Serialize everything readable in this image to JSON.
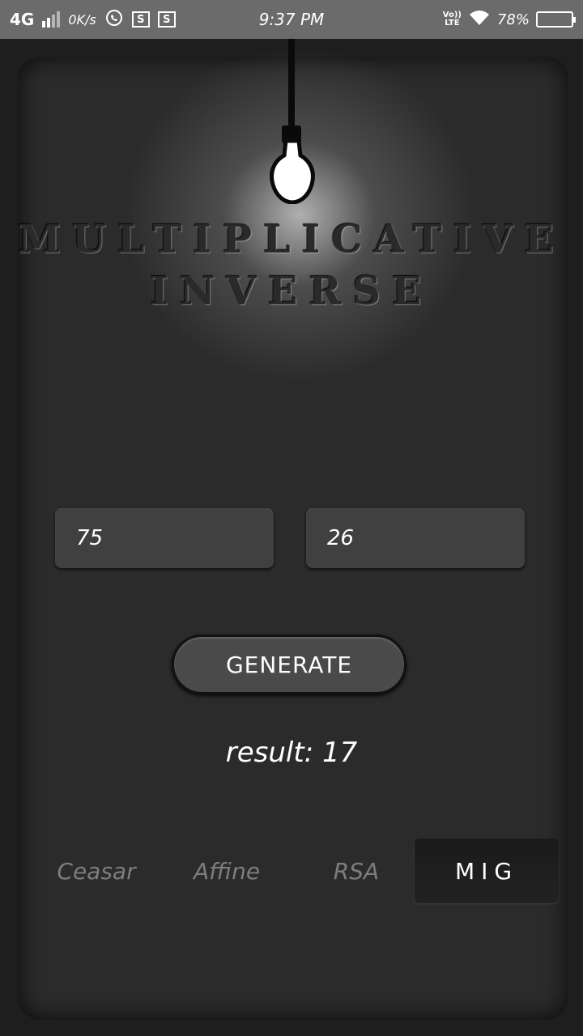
{
  "status_bar": {
    "network": "4G",
    "speed": "0K/s",
    "time": "9:37 PM",
    "volte_top": "Vo))",
    "volte_bottom": "LTE",
    "battery": "78%",
    "battery_level": 0.78
  },
  "title": {
    "line1": "MULTIPLICATIVE",
    "line2": "INVERSE"
  },
  "inputs": {
    "first_value": "75",
    "second_value": "26"
  },
  "generate_label": "GENERATE",
  "result_text": "result: 17",
  "tabs": [
    {
      "label": "Ceasar"
    },
    {
      "label": "Affine"
    },
    {
      "label": "RSA"
    },
    {
      "label": "MIG"
    }
  ],
  "active_tab": "MIG",
  "colors": {
    "background": "#1e1e1e",
    "panel": "#2b2b2b",
    "status_bar": "#6b6b6b"
  }
}
